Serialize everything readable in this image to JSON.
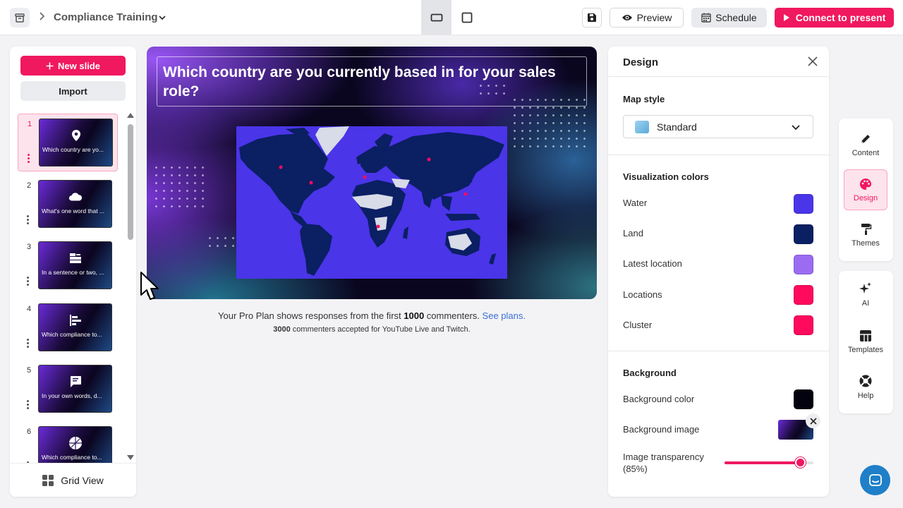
{
  "header": {
    "breadcrumb_title": "Compliance Training",
    "preview_label": "Preview",
    "schedule_label": "Schedule",
    "present_label": "Connect to present"
  },
  "sidebar": {
    "new_slide_label": "New slide",
    "import_label": "Import",
    "grid_view_label": "Grid View",
    "slides": [
      {
        "num": "1",
        "text": "Which country are yo...",
        "icon": "location-pin-icon"
      },
      {
        "num": "2",
        "text": "What's one word that ...",
        "icon": "cloud-icon"
      },
      {
        "num": "3",
        "text": "In a sentence or two, ...",
        "icon": "rating-bars-icon"
      },
      {
        "num": "4",
        "text": "Which compliance to...",
        "icon": "poll-bars-icon"
      },
      {
        "num": "5",
        "text": "In your own words, d...",
        "icon": "chat-message-icon"
      },
      {
        "num": "6",
        "text": "Which compliance to...",
        "icon": "spinner-wheel-icon"
      }
    ]
  },
  "canvas": {
    "question": "Which country are you currently based in for your sales role?",
    "notice_prefix": "Your Pro Plan shows responses from the first ",
    "notice_count": "1000",
    "notice_suffix": " commenters.",
    "notice_link": "See plans.",
    "notice2_count": "3000",
    "notice2_text": " commenters accepted for YouTube Live and Twitch."
  },
  "design": {
    "title": "Design",
    "map_style_heading": "Map style",
    "map_style_value": "Standard",
    "viz_heading": "Visualization colors",
    "colors": [
      {
        "label": "Water",
        "color": "#4a35e8"
      },
      {
        "label": "Land",
        "color": "#0b1f63"
      },
      {
        "label": "Latest location",
        "color": "#9b6cf2"
      },
      {
        "label": "Locations",
        "color": "#ff0a5c"
      },
      {
        "label": "Cluster",
        "color": "#ff0a5c"
      }
    ],
    "background_heading": "Background",
    "bg_color_label": "Background color",
    "bg_color": "#03030f",
    "bg_image_label": "Background image",
    "transparency_label": "Image transparency (85%)",
    "transparency_value": 0.85
  },
  "rail": {
    "content": "Content",
    "design": "Design",
    "themes": "Themes",
    "ai": "AI",
    "templates": "Templates",
    "help": "Help"
  }
}
